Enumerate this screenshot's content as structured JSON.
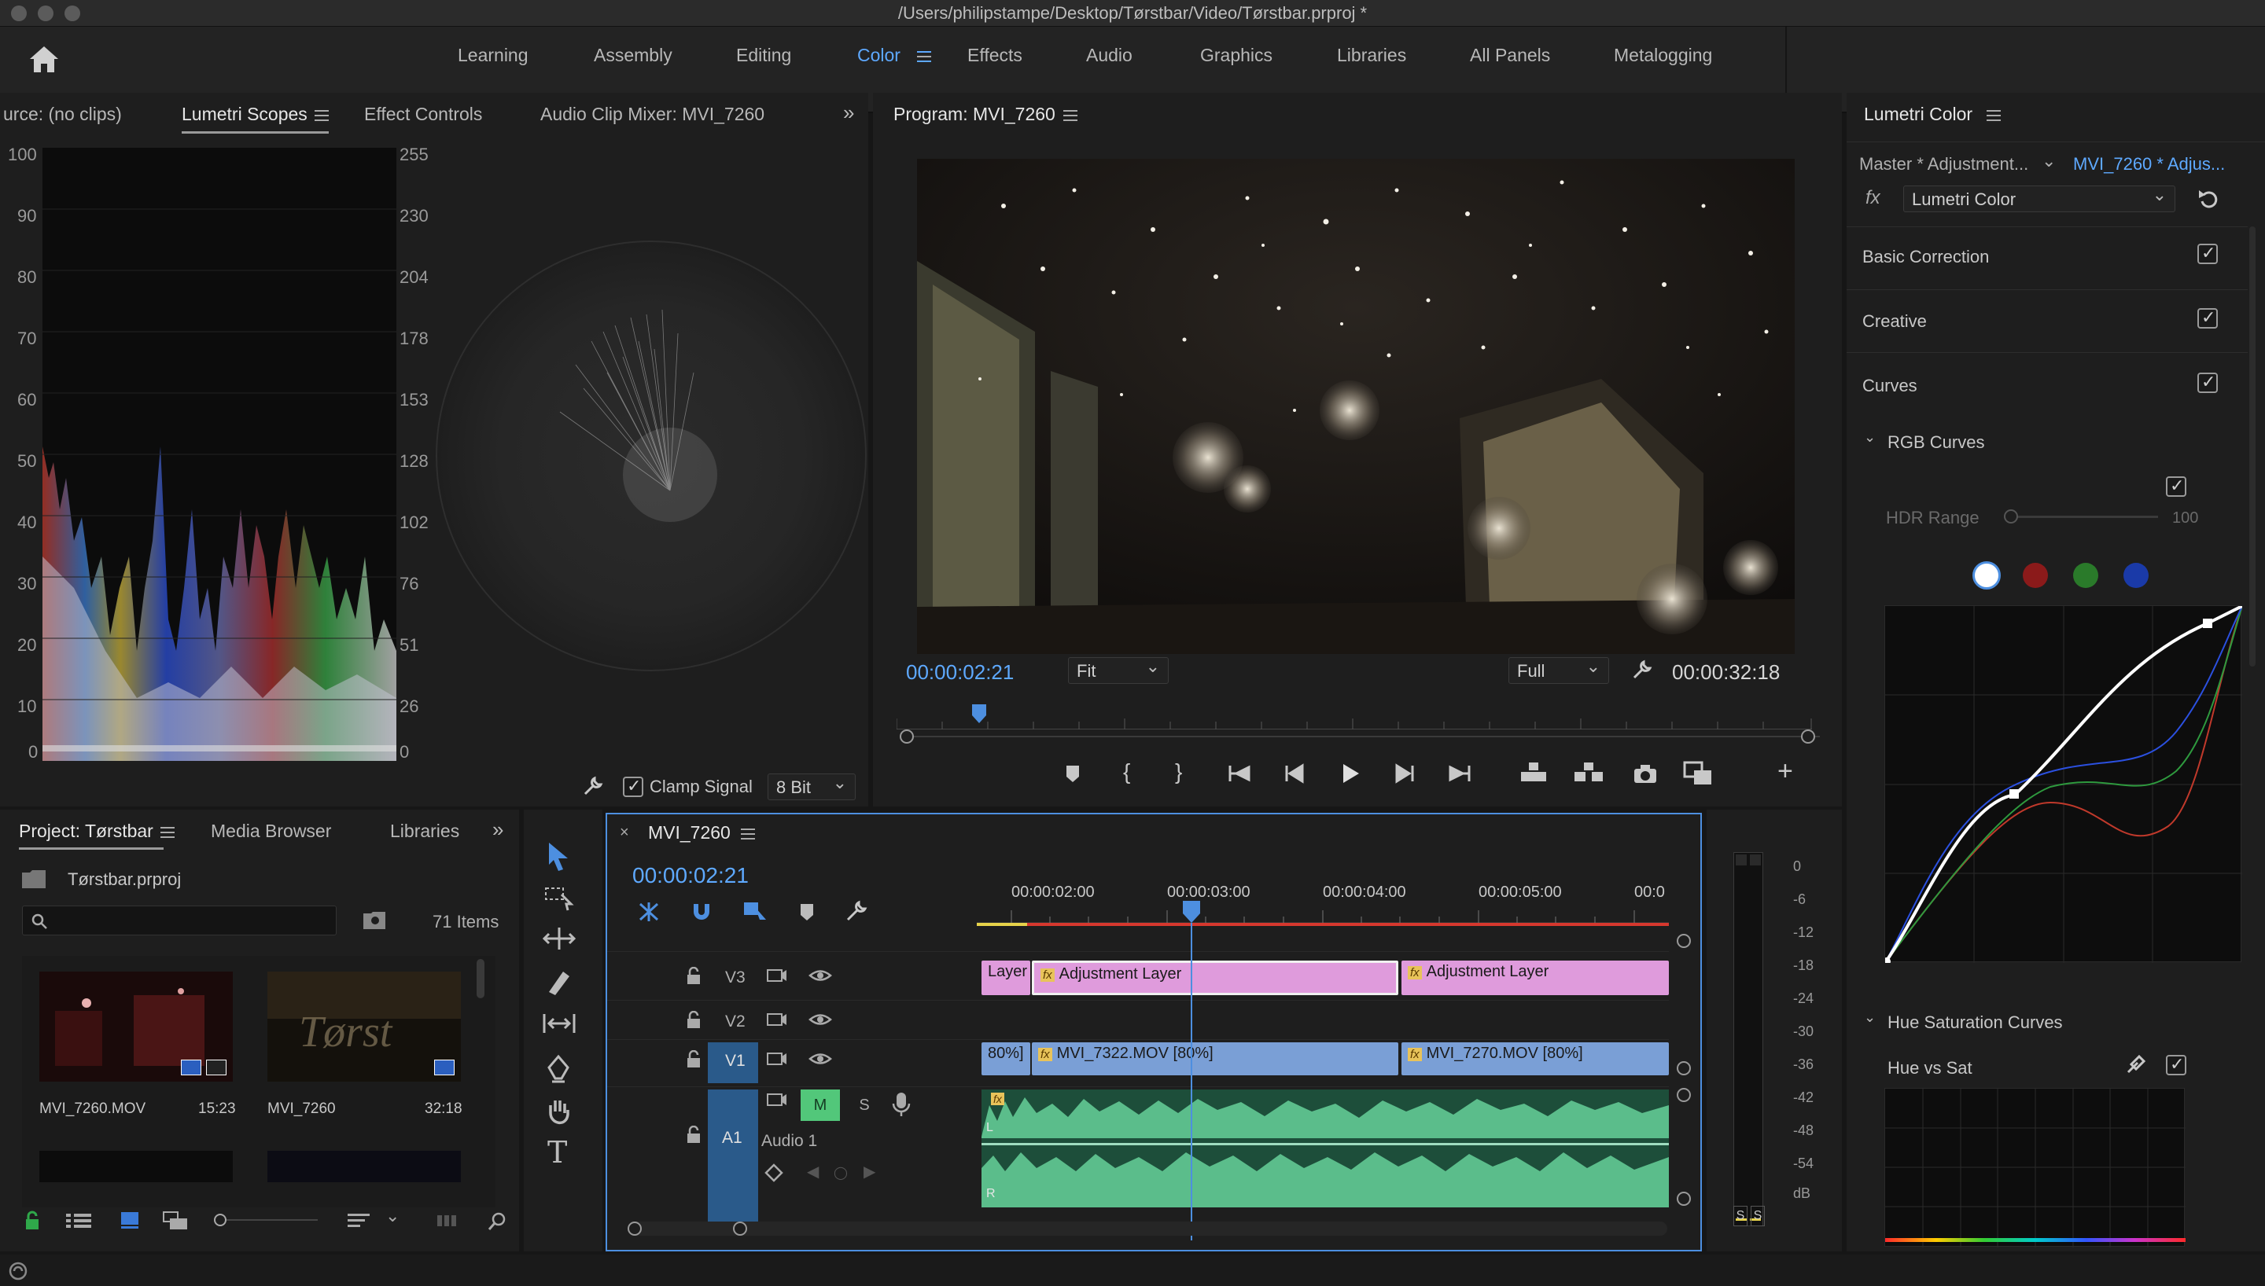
{
  "window": {
    "title": "/Users/philipstampe/Desktop/Tørstbar/Video/Tørstbar.prproj *"
  },
  "workspaces": [
    "Learning",
    "Assembly",
    "Editing",
    "Color",
    "Effects",
    "Audio",
    "Graphics",
    "Libraries",
    "All Panels",
    "Metalogging"
  ],
  "active_workspace": "Color",
  "scopes_panel": {
    "tabs": [
      "urce: (no clips)",
      "Lumetri Scopes",
      "Effect Controls",
      "Audio Clip Mixer: MVI_7260"
    ],
    "active_tab": "Lumetri Scopes",
    "left_scale": [
      "100",
      "90",
      "80",
      "70",
      "60",
      "50",
      "40",
      "30",
      "20",
      "10",
      "0"
    ],
    "right_scale": [
      "255",
      "230",
      "204",
      "178",
      "153",
      "128",
      "102",
      "76",
      "51",
      "26",
      "0"
    ],
    "clamp_signal_label": "Clamp Signal",
    "clamp_signal_checked": true,
    "bit_depth": "8 Bit"
  },
  "program_monitor": {
    "title": "Program: MVI_7260",
    "timecode_current": "00:00:02:21",
    "timecode_duration": "00:00:32:18",
    "zoom": "Fit",
    "resolution": "Full",
    "playhead_position": 0.09
  },
  "lumetri_color": {
    "title": "Lumetri Color",
    "master_label": "Master * Adjustment...",
    "clip_label": "MVI_7260 * Adjus...",
    "effect": "Lumetri Color",
    "sections": [
      {
        "label": "Basic Correction",
        "checked": true
      },
      {
        "label": "Creative",
        "checked": true
      },
      {
        "label": "Curves",
        "checked": true
      }
    ],
    "rgb_curves_label": "RGB Curves",
    "hdr_range_label": "HDR Range",
    "hdr_range_value": "100",
    "hue_sat_label": "Hue Saturation Curves",
    "hue_vs_sat_label": "Hue vs Sat",
    "channel_colors": [
      "#ffffff",
      "#8b1a1a",
      "#2a7a2a",
      "#1a3aa8"
    ]
  },
  "project_panel": {
    "tabs": [
      "Project: Tørstbar",
      "Media Browser",
      "Libraries"
    ],
    "project_file": "Tørstbar.prproj",
    "search_placeholder": "",
    "item_count": "71 Items",
    "items": [
      {
        "name": "MVI_7260.MOV",
        "duration": "15:23"
      },
      {
        "name": "MVI_7260",
        "duration": "32:18"
      }
    ]
  },
  "timeline": {
    "sequence": "MVI_7260",
    "timecode": "00:00:02:21",
    "ruler": [
      "00:00:02:00",
      "00:00:03:00",
      "00:00:04:00",
      "00:00:05:00",
      "00:0"
    ],
    "tracks": {
      "v3": "V3",
      "v2": "V2",
      "v1": "V1",
      "a1": "A1",
      "audio_name": "Audio 1",
      "mute_label": "M",
      "solo_label": "S"
    },
    "clips": {
      "v3_a": "Layer",
      "v3_b": "Adjustment Layer",
      "v3_c": "Adjustment Layer",
      "v1_a": "80%]",
      "v1_b": "MVI_7322.MOV [80%]",
      "v1_c": "MVI_7270.MOV [80%]",
      "fx_badge": "fx",
      "audio_l": "L",
      "audio_r": "R"
    }
  },
  "audio_meter": {
    "scale": [
      "0",
      "-6",
      "-12",
      "-18",
      "-24",
      "-30",
      "-36",
      "-42",
      "-48",
      "-54",
      "dB"
    ],
    "solo_labels": [
      "S",
      "S"
    ]
  },
  "icons": {
    "home": "home-icon",
    "search": "search-icon",
    "wrench": "wrench-icon",
    "camera": "camera-icon"
  }
}
